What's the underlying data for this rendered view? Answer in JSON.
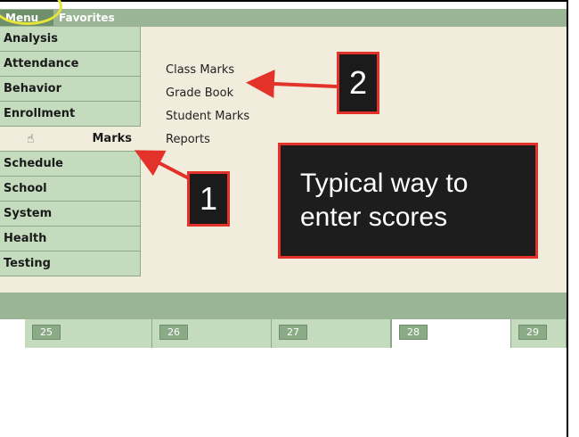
{
  "tabs": {
    "menu": "Menu",
    "favorites": "Favorites"
  },
  "sidebar": {
    "items": [
      "Analysis",
      "Attendance",
      "Behavior",
      "Enrollment",
      "Marks",
      "Schedule",
      "School",
      "System",
      "Health",
      "Testing"
    ],
    "active_index": 4
  },
  "submenu": {
    "items": [
      "Class Marks",
      "Grade Book",
      "Student Marks",
      "Reports"
    ]
  },
  "calendar": {
    "days": [
      "25",
      "26",
      "27",
      "28",
      "29"
    ],
    "highlighted_day": "28"
  },
  "annotations": {
    "badge_1": "1",
    "badge_2": "2",
    "callout_line1": "Typical way to",
    "callout_line2": "enter scores"
  },
  "colors": {
    "annotation_red": "#e2322a",
    "highlight_yellow": "#e8e43a",
    "menu_green": "#c4dbbd",
    "panel_beige": "#f1ecdc"
  }
}
